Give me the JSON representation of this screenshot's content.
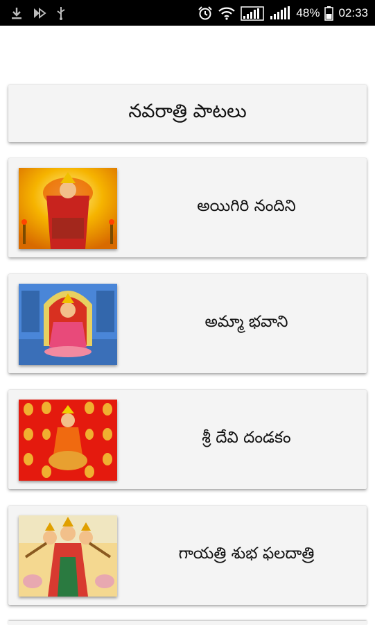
{
  "status_bar": {
    "battery": "48%",
    "time": "02:33",
    "left_icons": [
      "download-icon",
      "app-notification-icon",
      "usb-icon"
    ],
    "right_icons": [
      "alarm-icon",
      "wifi-icon",
      "signal-icon-1",
      "signal-icon-2",
      "battery-icon"
    ]
  },
  "header": {
    "title": "నవరాత్రి పాటలు"
  },
  "songs": [
    {
      "title": "అయిగిరి నందిని",
      "thumbnail": "durga-thumbnail"
    },
    {
      "title": "అమ్మా భవాని",
      "thumbnail": "bhavani-thumbnail"
    },
    {
      "title": "శ్రీ దేవి దండకం",
      "thumbnail": "devi-red-thumbnail"
    },
    {
      "title": "గాయత్రి శుభ ఫలదాత్రి",
      "thumbnail": "gayatri-thumbnail"
    }
  ]
}
